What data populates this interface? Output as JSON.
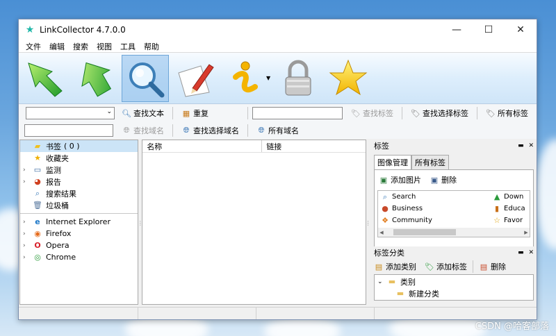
{
  "window": {
    "title": "LinkCollector 4.7.0.0",
    "controls": {
      "minimize": "—",
      "maximize": "☐",
      "close": "✕"
    }
  },
  "menu": [
    "文件",
    "编辑",
    "搜索",
    "视图",
    "工具",
    "帮助"
  ],
  "big_toolbar": [
    {
      "name": "back-arrow-icon"
    },
    {
      "name": "forward-arrow-icon"
    },
    {
      "name": "magnifier-icon",
      "active": true
    },
    {
      "name": "pencil-paper-icon"
    },
    {
      "name": "info-icon",
      "dropdown": true
    },
    {
      "name": "padlock-icon"
    },
    {
      "name": "star-icon"
    }
  ],
  "search_row1": {
    "combo_value": "",
    "find_text": "查找文本",
    "duplicate": "重复",
    "tag_input_value": "",
    "find_tag": "查找标签",
    "find_selected_tag": "查找选择标签",
    "all_tags": "所有标签"
  },
  "search_row2": {
    "domain_input_value": "",
    "find_domain": "查找域名",
    "find_selected_domain": "查找选择域名",
    "all_domains": "所有域名"
  },
  "left_tree": {
    "items": [
      {
        "label": "书签",
        "count": "( 0 )",
        "selected": true
      },
      {
        "label": "收藏夹"
      },
      {
        "label": "监测"
      },
      {
        "label": "报告"
      },
      {
        "label": "搜索结果"
      },
      {
        "label": "垃圾桶"
      }
    ],
    "browsers": [
      {
        "label": "Internet Explorer"
      },
      {
        "label": "Firefox"
      },
      {
        "label": "Opera"
      },
      {
        "label": "Chrome"
      }
    ]
  },
  "center": {
    "col_name": "名称",
    "col_link": "链接"
  },
  "tags_panel": {
    "title": "标签",
    "tabs": [
      "图像管理",
      "所有标签"
    ],
    "add_image": "添加图片",
    "delete": "删除",
    "tags_left": [
      "Search",
      "Business",
      "Community"
    ],
    "tags_right": [
      "Down",
      "Educa",
      "Favor"
    ]
  },
  "category_panel": {
    "title": "标签分类",
    "add_category": "添加类别",
    "add_tag": "添加标签",
    "delete": "删除",
    "tree_root": "类别",
    "tree_child": "新建分类"
  },
  "watermark": "CSDN @哈客部落"
}
